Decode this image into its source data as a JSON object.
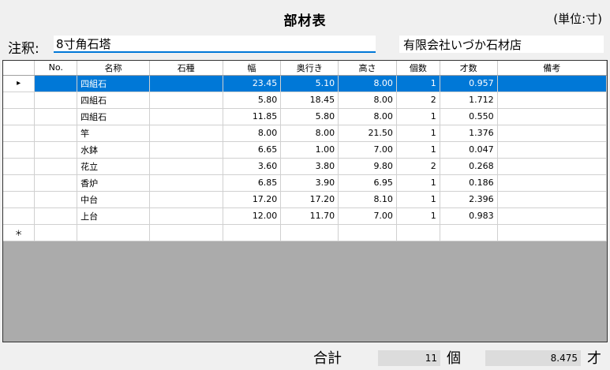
{
  "header": {
    "title": "部材表",
    "unit": "(単位:寸)"
  },
  "order": {
    "label": "注釈:",
    "value": "8寸角石塔",
    "shop": "有限会社いづか石材店"
  },
  "grid": {
    "columns": [
      "No.",
      "名称",
      "石種",
      "幅",
      "奥行き",
      "高さ",
      "個数",
      "才数",
      "備考"
    ],
    "current_row_marker": "▸",
    "new_row_marker": "＊",
    "rows": [
      {
        "no": "",
        "name": "四組石",
        "stone": "",
        "width": "23.45",
        "depth": "5.10",
        "height": "8.00",
        "count": "1",
        "sai": "0.957",
        "note": ""
      },
      {
        "no": "",
        "name": "四組石",
        "stone": "",
        "width": "5.80",
        "depth": "18.45",
        "height": "8.00",
        "count": "2",
        "sai": "1.712",
        "note": ""
      },
      {
        "no": "",
        "name": "四組石",
        "stone": "",
        "width": "11.85",
        "depth": "5.80",
        "height": "8.00",
        "count": "1",
        "sai": "0.550",
        "note": ""
      },
      {
        "no": "",
        "name": "竿",
        "stone": "",
        "width": "8.00",
        "depth": "8.00",
        "height": "21.50",
        "count": "1",
        "sai": "1.376",
        "note": ""
      },
      {
        "no": "",
        "name": "水鉢",
        "stone": "",
        "width": "6.65",
        "depth": "1.00",
        "height": "7.00",
        "count": "1",
        "sai": "0.047",
        "note": ""
      },
      {
        "no": "",
        "name": "花立",
        "stone": "",
        "width": "3.60",
        "depth": "3.80",
        "height": "9.80",
        "count": "2",
        "sai": "0.268",
        "note": ""
      },
      {
        "no": "",
        "name": "香炉",
        "stone": "",
        "width": "6.85",
        "depth": "3.90",
        "height": "6.95",
        "count": "1",
        "sai": "0.186",
        "note": ""
      },
      {
        "no": "",
        "name": "中台",
        "stone": "",
        "width": "17.20",
        "depth": "17.20",
        "height": "8.10",
        "count": "1",
        "sai": "2.396",
        "note": ""
      },
      {
        "no": "",
        "name": "上台",
        "stone": "",
        "width": "12.00",
        "depth": "11.70",
        "height": "7.00",
        "count": "1",
        "sai": "0.983",
        "note": ""
      }
    ]
  },
  "totals": {
    "label": "合計",
    "count": "11",
    "count_unit": "個",
    "sai": "8.475",
    "sai_unit": "才"
  },
  "colors": {
    "selection": "#0078d7",
    "empty_area": "#ababab"
  }
}
